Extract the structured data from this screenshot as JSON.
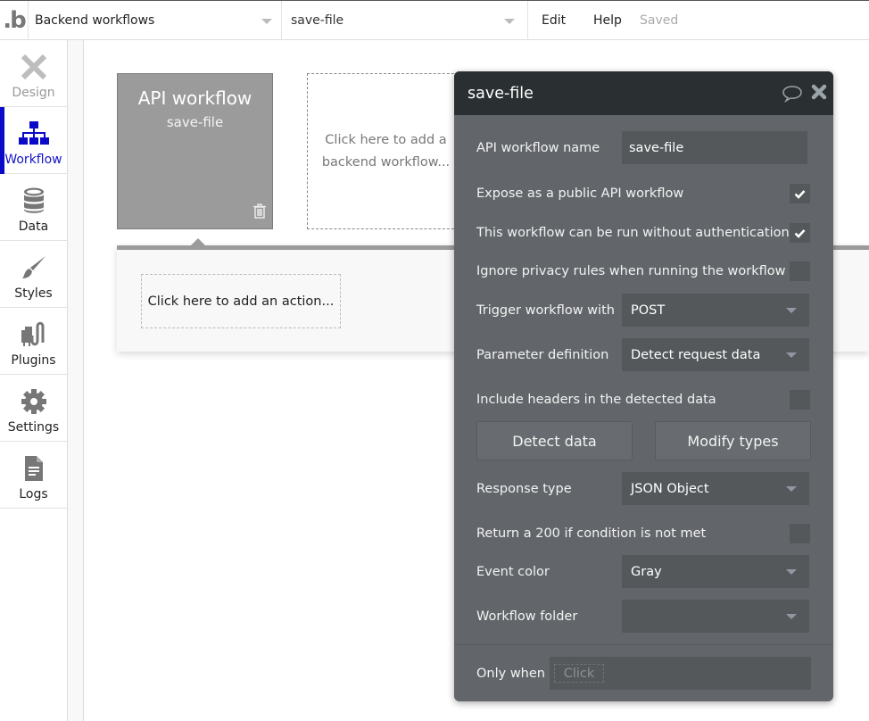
{
  "topbar": {
    "logo": ".b",
    "page_selector": "Backend workflows",
    "workflow_selector": "save-file",
    "menu": {
      "edit": "Edit",
      "help": "Help"
    },
    "status": "Saved"
  },
  "sidebar": {
    "items": [
      {
        "label": "Design",
        "icon": "design-icon",
        "state": "disabled"
      },
      {
        "label": "Workflow",
        "icon": "workflow-icon",
        "state": "active"
      },
      {
        "label": "Data",
        "icon": "database-icon",
        "state": "normal"
      },
      {
        "label": "Styles",
        "icon": "brush-icon",
        "state": "normal"
      },
      {
        "label": "Plugins",
        "icon": "plug-icon",
        "state": "normal"
      },
      {
        "label": "Settings",
        "icon": "gear-icon",
        "state": "normal"
      },
      {
        "label": "Logs",
        "icon": "document-icon",
        "state": "normal"
      }
    ]
  },
  "canvas": {
    "workflow_card": {
      "title": "API workflow",
      "name": "save-file",
      "color": "#9b9b9b"
    },
    "add_workflow": "Click here to add a backend workflow...",
    "add_action": "Click here to add an action..."
  },
  "editor": {
    "title": "save-file",
    "name_label": "API workflow name",
    "name_value": "save-file",
    "expose_label": "Expose as a public API workflow",
    "expose_checked": true,
    "no_auth_label": "This workflow can be run without authentication",
    "no_auth_checked": true,
    "ignore_privacy_label": "Ignore privacy rules when running the workflow",
    "ignore_privacy_checked": false,
    "trigger_label": "Trigger workflow with",
    "trigger_value": "POST",
    "param_label": "Parameter definition",
    "param_value": "Detect request data",
    "headers_label": "Include headers in the detected data",
    "headers_checked": false,
    "detect_button": "Detect data",
    "modify_button": "Modify types",
    "response_label": "Response type",
    "response_value": "JSON Object",
    "return200_label": "Return a 200 if condition is not met",
    "return200_checked": false,
    "event_color_label": "Event color",
    "event_color_value": "Gray",
    "folder_label": "Workflow folder",
    "folder_value": "",
    "only_when_label": "Only when",
    "only_when_placeholder": "Click"
  }
}
